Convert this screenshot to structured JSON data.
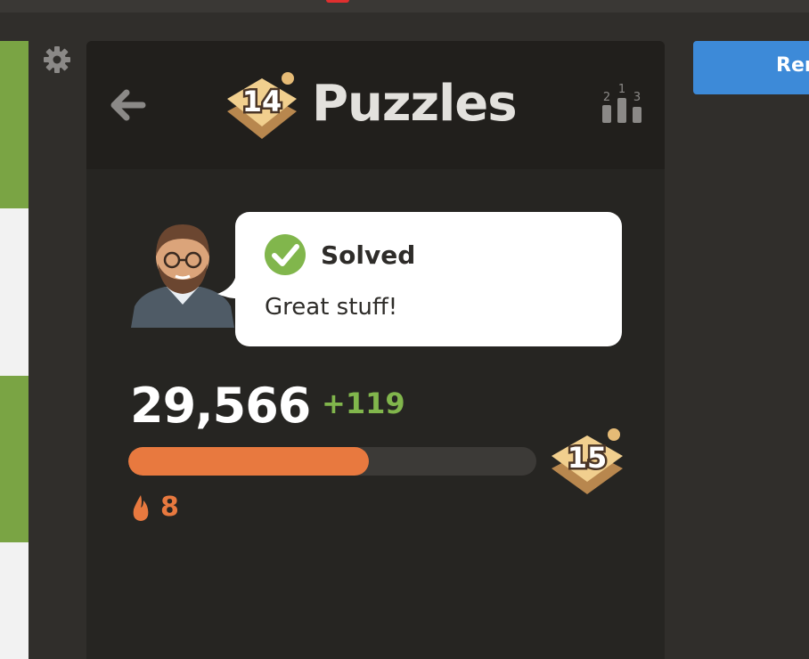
{
  "header": {
    "title": "Puzzles",
    "rank_badge_number": "14",
    "leaderboard_ranks": [
      "2",
      "1",
      "3"
    ]
  },
  "feedback": {
    "status": "Solved",
    "message": "Great stuff!"
  },
  "rating": {
    "score": "29,566",
    "delta": "+119",
    "progress_percent": 59,
    "next_badge_number": "15"
  },
  "streak": {
    "count": "8"
  },
  "action_button": {
    "label": "Rem"
  },
  "colors": {
    "accent_green": "#81b64c",
    "progress_orange": "#e8793f",
    "button_blue": "#3d8ad8",
    "panel_bg": "#262522"
  },
  "icons": [
    "gear-icon",
    "back-arrow-icon",
    "puzzle-badge-icon",
    "leaderboard-icon",
    "check-icon",
    "flame-icon",
    "coach-avatar"
  ]
}
